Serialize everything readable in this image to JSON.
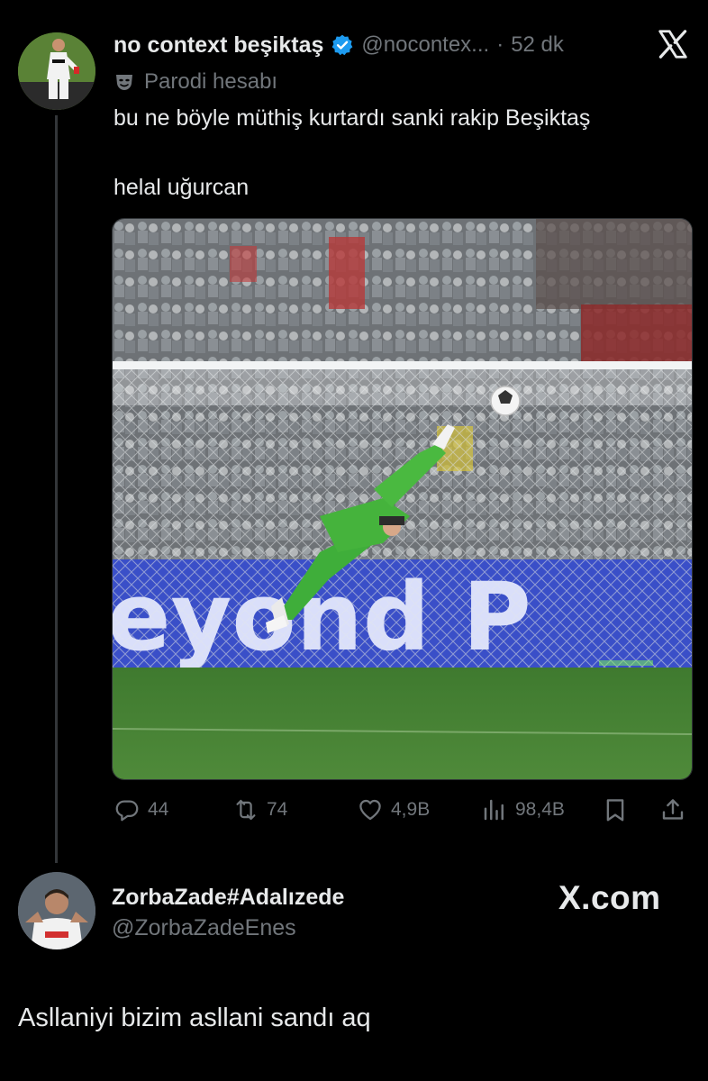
{
  "tweet": {
    "author_name": "no context beşiktaş",
    "handle": "@nocontex...",
    "separator": "·",
    "time": "52 dk",
    "parody_label": "Parodi hesabı",
    "text_line1": "bu ne böyle müthiş kurtardı sanki rakip Beşiktaş",
    "text_line2": "helal uğurcan",
    "media": {
      "banner_text": "eyond P",
      "description_icon": "goalkeeper-save-photo"
    },
    "actions": {
      "replies": "44",
      "reposts": "74",
      "likes": "4,9B",
      "views": "98,4B"
    }
  },
  "quote": {
    "author_name": "ZorbaZade#Adalızede",
    "handle": "@ZorbaZadeEnes",
    "watermark": "X.com"
  },
  "comment": {
    "text": "Asllaniyi bizim asllani sandı aq"
  },
  "colors": {
    "background": "#000000",
    "text_primary": "#e7e9ea",
    "text_secondary": "#71767b",
    "verified_blue": "#1d9bf0"
  }
}
